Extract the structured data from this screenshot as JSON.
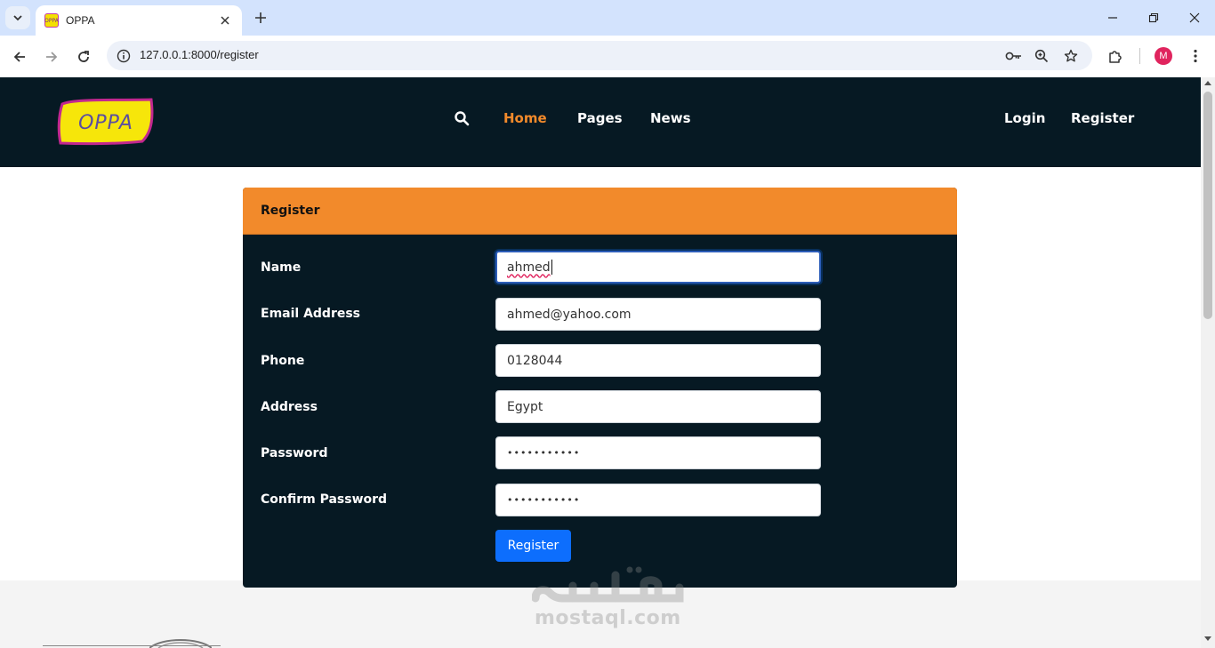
{
  "browser": {
    "tab_title": "OPPA",
    "url": "127.0.0.1:8000/register",
    "profile_initial": "M",
    "favicon_text": "OPPA"
  },
  "site": {
    "logo_text": "OPPA",
    "nav": {
      "home": "Home",
      "pages": "Pages",
      "news": "News",
      "login": "Login",
      "register": "Register"
    },
    "accent_color": "#f28a2b",
    "navbar_color": "#061923"
  },
  "form": {
    "header": "Register",
    "fields": [
      {
        "label": "Name",
        "value": "ahmed"
      },
      {
        "label": "Email Address",
        "value": "ahmed@yahoo.com"
      },
      {
        "label": "Phone",
        "value": "0128044"
      },
      {
        "label": "Address",
        "value": "Egypt"
      },
      {
        "label": "Password",
        "value": "•••••••••••"
      },
      {
        "label": "Confirm Password",
        "value": "•••••••••••"
      }
    ],
    "submit_label": "Register",
    "submit_color": "#0d6efd"
  },
  "watermark": {
    "arabic": "مستقل",
    "latin": "mostaql.com"
  }
}
